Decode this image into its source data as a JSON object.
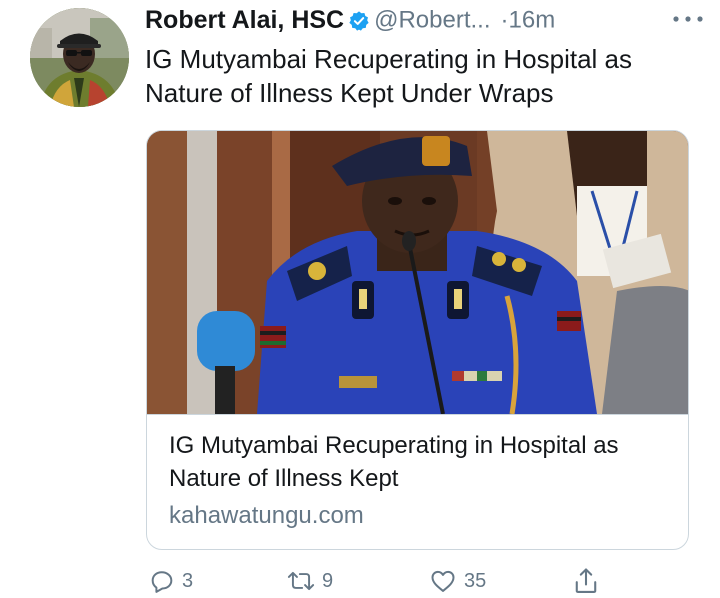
{
  "tweet": {
    "author": {
      "display_name": "Robert Alai, HSC",
      "handle": "@Robert...",
      "verified": true
    },
    "time_separator": "·",
    "time": "16m",
    "text": "IG Mutyambai Recuperating in Hospital as Nature of Illness Kept Under Wraps"
  },
  "card": {
    "title": "IG Mutyambai Recuperating in Hospital as Nature of Illness Kept",
    "domain": "kahawatungu.com"
  },
  "actions": {
    "reply_count": "3",
    "retweet_count": "9",
    "like_count": "35"
  },
  "icons": {
    "verified": "verified-badge-icon",
    "more": "more-horizontal-icon",
    "reply": "reply-icon",
    "retweet": "retweet-icon",
    "like": "heart-icon",
    "share": "share-icon"
  },
  "colors": {
    "verified_blue": "#1da1f2",
    "secondary_text": "#657786",
    "primary_text": "#14171a"
  }
}
